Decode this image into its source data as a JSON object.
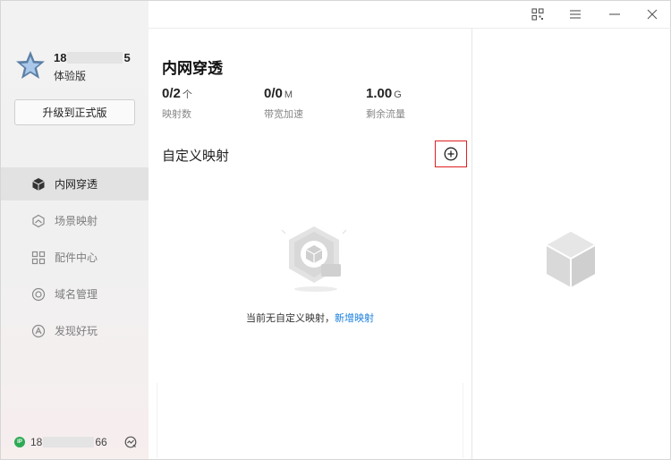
{
  "sidebar": {
    "user": {
      "name_prefix": "18",
      "name_suffix": "5",
      "plan": "体验版"
    },
    "upgrade_label": "升级到正式版",
    "items": [
      {
        "label": "内网穿透",
        "icon": "cube-icon",
        "active": true
      },
      {
        "label": "场景映射",
        "icon": "scene-icon",
        "active": false
      },
      {
        "label": "配件中心",
        "icon": "grid-icon",
        "active": false
      },
      {
        "label": "域名管理",
        "icon": "domain-icon",
        "active": false
      },
      {
        "label": "发现好玩",
        "icon": "discover-icon",
        "active": false
      }
    ],
    "footer": {
      "ip_badge": "IP",
      "ip_prefix": "18",
      "ip_suffix": "66"
    }
  },
  "titlebar": {
    "buttons": [
      "qr-code-icon",
      "menu-icon",
      "minimize-icon",
      "close-icon"
    ]
  },
  "main": {
    "title": "内网穿透",
    "stats": [
      {
        "value": "0/2",
        "unit": "个",
        "label": "映射数"
      },
      {
        "value": "0/0",
        "unit": "M",
        "label": "带宽加速"
      },
      {
        "value": "1.00",
        "unit": "G",
        "label": "剩余流量"
      }
    ],
    "section_title": "自定义映射",
    "empty_text": "当前无自定义映射，",
    "empty_link": "新增映射"
  },
  "colors": {
    "accent": "#1a7fe0",
    "highlight_border": "#e02020",
    "ip_badge": "#2eaa55",
    "avatar_star": "#5b7fa6"
  }
}
